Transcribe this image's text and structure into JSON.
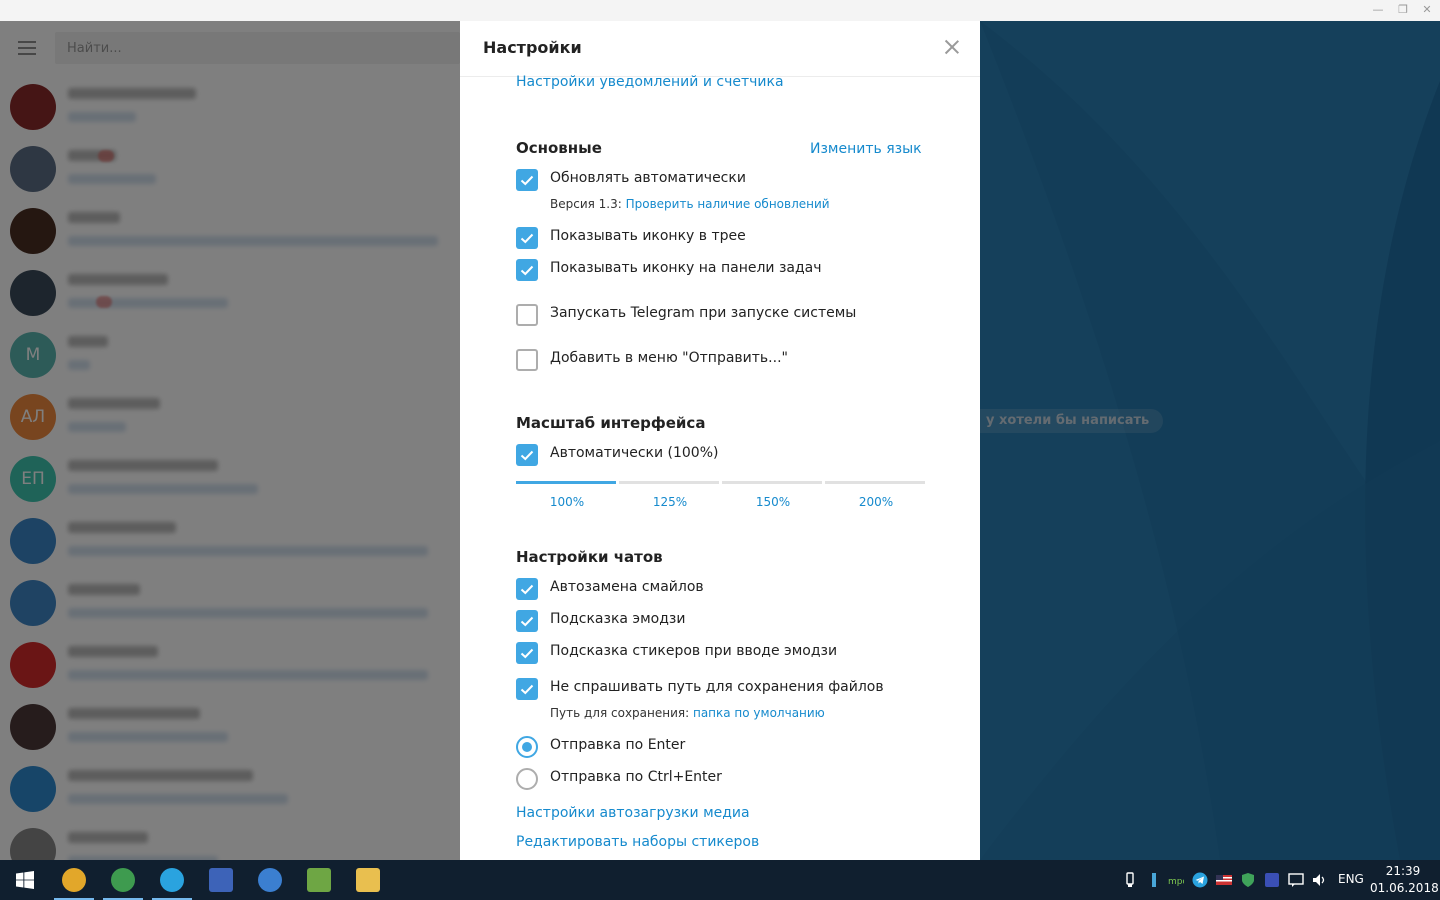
{
  "search": {
    "placeholder": "Найти..."
  },
  "chats": [
    {
      "initials": "",
      "color": "#8b2a2a",
      "unread_badge": false
    },
    {
      "initials": "",
      "color": "#5c6f86",
      "unread_badge": true
    },
    {
      "initials": "",
      "color": "#4a2e22",
      "unread_badge": false
    },
    {
      "initials": "",
      "color": "#3a4a5a",
      "unread_badge": true
    },
    {
      "initials": "М",
      "color": "#5bb6b1"
    },
    {
      "initials": "АЛ",
      "color": "#f08a3e"
    },
    {
      "initials": "ЕП",
      "color": "#3ec6b0"
    },
    {
      "initials": "",
      "color": "#3a86c9"
    },
    {
      "initials": "",
      "color": "#3f86c6"
    },
    {
      "initials": "",
      "color": "#d42a2a"
    },
    {
      "initials": "",
      "color": "#4d3838"
    },
    {
      "initials": "",
      "color": "#2e8bd0"
    },
    {
      "initials": "",
      "color": "#888888"
    }
  ],
  "chat_bg": {
    "empty_hint": "у хотели бы написать"
  },
  "settings": {
    "title": "Настройки",
    "notifications_link": "Настройки уведомлений и счетчика",
    "general": {
      "title": "Основные",
      "change_language": "Изменить язык",
      "auto_update": {
        "label": "Обновлять автоматически",
        "checked": true
      },
      "version_prefix": "Версия 1.3: ",
      "check_updates": "Проверить наличие обновлений",
      "tray_icon": {
        "label": "Показывать иконку в трее",
        "checked": true
      },
      "taskbar_icon": {
        "label": "Показывать иконку на панели задач",
        "checked": true
      },
      "autostart": {
        "label": "Запускать Telegram при запуске системы",
        "checked": false
      },
      "send_to_menu": {
        "label": "Добавить в меню \"Отправить...\"",
        "checked": false
      }
    },
    "scale": {
      "title": "Масштаб интерфейса",
      "auto": {
        "label": "Автоматически (100%)",
        "checked": true
      },
      "options": [
        "100%",
        "125%",
        "150%",
        "200%"
      ],
      "selected_index": 0
    },
    "chats": {
      "title": "Настройки чатов",
      "replace_emoji": {
        "label": "Автозамена смайлов",
        "checked": true
      },
      "suggest_emoji": {
        "label": "Подсказка эмодзи",
        "checked": true
      },
      "suggest_stickers": {
        "label": "Подсказка стикеров при вводе эмодзи",
        "checked": true
      },
      "dont_ask_path": {
        "label": "Не спрашивать путь для сохранения файлов",
        "checked": true
      },
      "save_path_prefix": "Путь для сохранения: ",
      "save_path_link": "папка по умолчанию",
      "send_enter": {
        "label": "Отправка по Enter",
        "selected": true
      },
      "send_ctrl_enter": {
        "label": "Отправка по Ctrl+Enter",
        "selected": false
      },
      "media_autoload": "Настройки автозагрузки медиа",
      "edit_stickers": "Редактировать наборы стикеров"
    }
  },
  "taskbar": {
    "apps": [
      {
        "icon": "chrome-icon",
        "color": "#e2a72a"
      },
      {
        "icon": "chrome-icon",
        "color": "#3e9b4f"
      },
      {
        "icon": "telegram-icon",
        "color": "#2aa3df"
      },
      {
        "icon": "floppy-icon",
        "color": "#3d63b8"
      },
      {
        "icon": "qbittorrent-icon",
        "color": "#3b7fd0"
      },
      {
        "icon": "chart-app-icon",
        "color": "#6ea644"
      },
      {
        "icon": "folder-icon",
        "color": "#e9bf4f"
      }
    ],
    "lang": "ENG",
    "time": "21:39",
    "date": "01.06.2018"
  }
}
